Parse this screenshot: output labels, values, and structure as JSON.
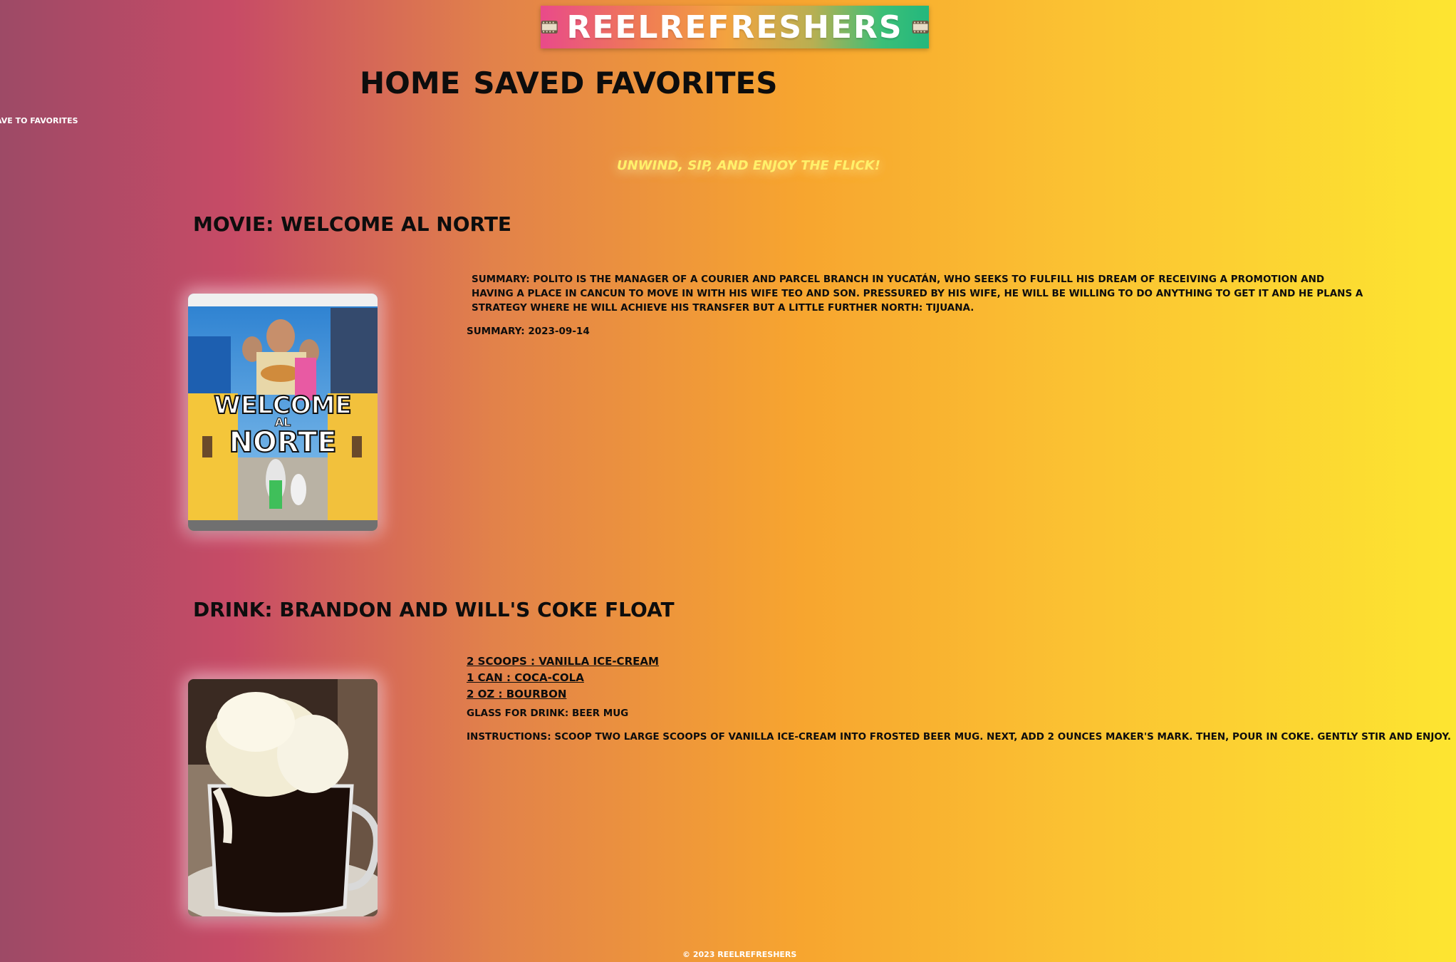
{
  "header": {
    "logo_text": "ReelRefreshers",
    "logo_icon": "film-projector-icon"
  },
  "nav": {
    "home": "Home",
    "saved": "Saved Favorites"
  },
  "save_link": "ave to Favorites",
  "tagline": "Unwind, Sip, and Enjoy the Flick!",
  "movie": {
    "title": "Movie: Welcome Al Norte",
    "poster_text_line1": "WELCOME",
    "poster_text_line2": "AL",
    "poster_text_line3": "NORTE",
    "summary": "Summary: Polito is the manager of a courier and parcel branch in Yucatán, who seeks to fulfill his dream of receiving a promotion and having a place in Cancun to move in with his wife Teo and son. Pressured by his wife, he will be willing to do anything to get it and he plans a strategy where he will achieve his transfer but a little further north: Tijuana.",
    "release": "Summary: 2023-09-14"
  },
  "drink": {
    "title": "Drink: Brandon and Will's Coke Float",
    "ingredients": [
      "2 scoops : Vanilla Ice-Cream",
      "1 can : Coca-Cola",
      "2 oz : Bourbon"
    ],
    "glass": "Glass for drink: Beer mug",
    "instructions": "Instructions: Scoop two large scoops of vanilla ice-cream into frosted beer mug. Next, add 2 ounces Maker's Mark. Then, pour in Coke. Gently stir and enjoy."
  },
  "footer": "© 2023 ReelRefreshers"
}
